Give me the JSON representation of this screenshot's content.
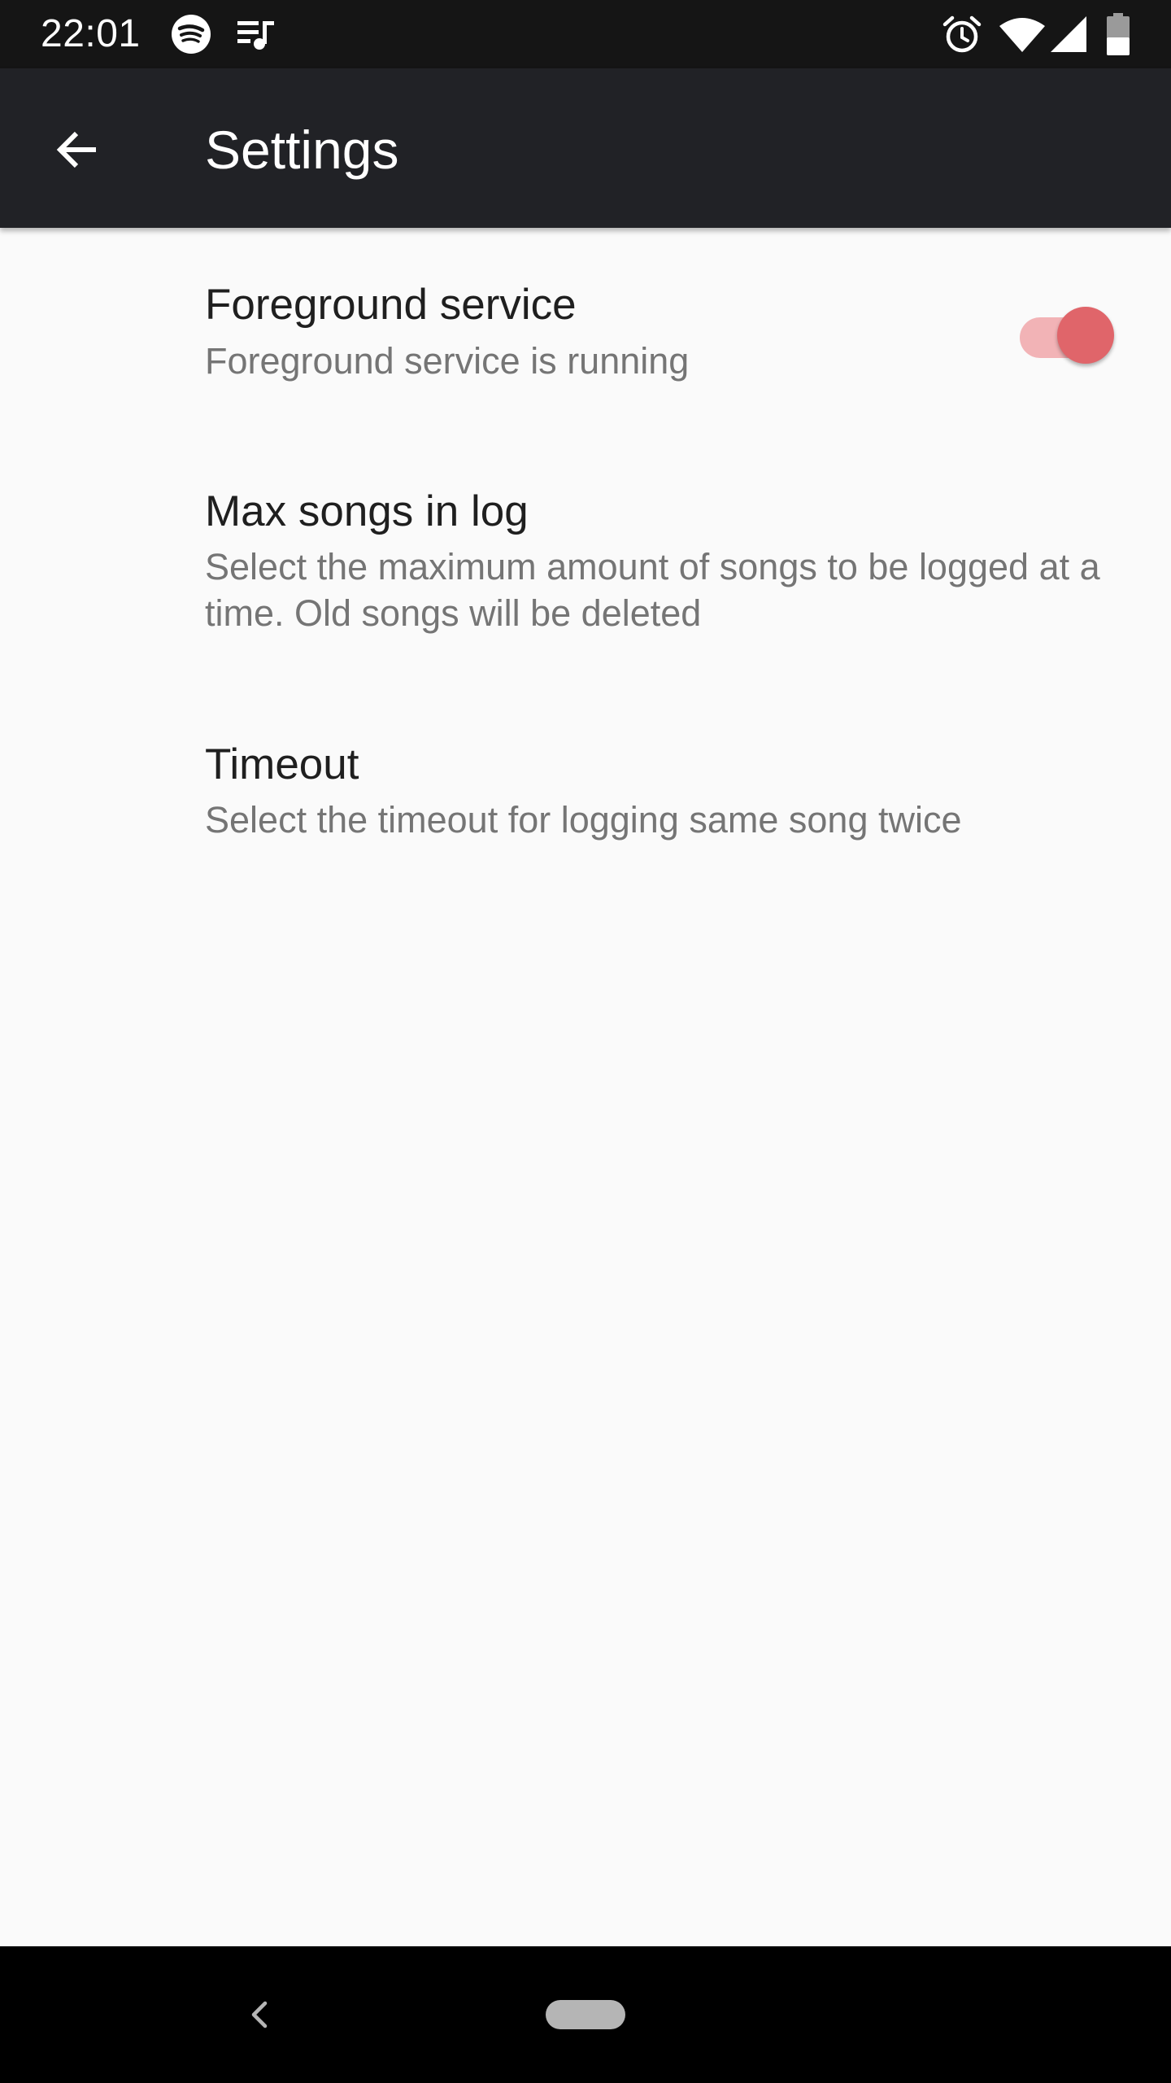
{
  "status_bar": {
    "time": "22:01",
    "icons": [
      "spotify-icon",
      "music-queue-icon",
      "alarm-icon",
      "wifi-icon",
      "signal-icon",
      "battery-icon"
    ]
  },
  "app_bar": {
    "title": "Settings",
    "back_icon": "arrow-back-icon",
    "background": "#212226"
  },
  "preferences": [
    {
      "title": "Foreground service",
      "summary": "Foreground service is running",
      "switch": {
        "checked": true,
        "accent": "#e0656a"
      }
    },
    {
      "title": "Max songs in log",
      "summary": "Select the maximum amount of songs to be logged at a time. Old songs will be deleted"
    },
    {
      "title": "Timeout",
      "summary": "Select the timeout for logging same song twice"
    }
  ],
  "nav_bar": {
    "back_icon": "nav-back-icon",
    "home_icon": "home-pill-icon"
  }
}
